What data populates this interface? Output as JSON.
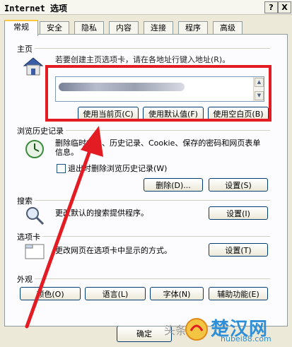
{
  "window": {
    "title": "Internet 选项",
    "help_btn": "?",
    "close_btn": "X"
  },
  "tabs": [
    "常规",
    "安全",
    "隐私",
    "内容",
    "连接",
    "程序",
    "高级"
  ],
  "home": {
    "group_label": "主页",
    "description": "若要创建主页选项卡，请在各地址行键入地址(R)。",
    "buttons": {
      "current": "使用当前页(C)",
      "default": "使用默认值(F)",
      "blank": "使用空白页(B)"
    }
  },
  "history": {
    "group_label": "浏览历史记录",
    "description": "删除临时文件、历史记录、Cookie、保存的密码和网页表单信息。",
    "checkbox_label": "退出时删除浏览历史记录(W)",
    "delete_button": "删除(D)...",
    "settings_button": "设置(S)"
  },
  "search": {
    "group_label": "搜索",
    "description": "更改默认的搜索提供程序。",
    "settings_button": "设置(I)"
  },
  "tabsgroup": {
    "group_label": "选项卡",
    "description": "更改网页在选项卡中显示的方式。",
    "settings_button": "设置(T)"
  },
  "appearance": {
    "group_label": "外观",
    "buttons": [
      "颜色(O)",
      "语言(L)",
      "字体(N)",
      "辅助功能(E)"
    ]
  },
  "footer": {
    "ok_button": "确定"
  },
  "watermark": {
    "left_text": "头条",
    "brand": "楚汉网",
    "url": "hubei88.com"
  },
  "colors": {
    "highlight_box": "#e31b23",
    "arrow": "#e31b23",
    "tab_accent": "#ffc83c"
  }
}
